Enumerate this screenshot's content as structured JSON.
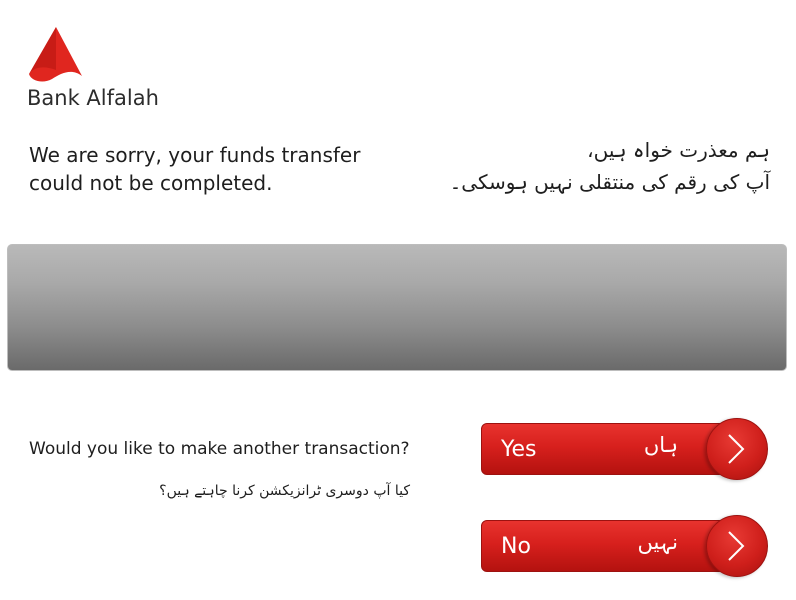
{
  "brand": {
    "name": "Bank Alfalah",
    "color": "#e0261f"
  },
  "message": {
    "english": [
      "We are sorry, your funds transfer",
      "could not be completed."
    ],
    "urdu": [
      "ہم معذرت خواہ ہیں،",
      "آپ کی رقم کی منتقلی نہیں ہوسکی۔"
    ]
  },
  "prompt": {
    "english": "Would you like to make another transaction?",
    "urdu": "کیا آپ دوسری ٹرانزیکشن کرنا چاہتے ہیں؟"
  },
  "buttons": {
    "yes": {
      "english": "Yes",
      "urdu": "ہاں",
      "icon": "chevron-right-icon"
    },
    "no": {
      "english": "No",
      "urdu": "نہیں",
      "icon": "chevron-right-icon"
    }
  },
  "colors": {
    "button_red": "#d7201d",
    "panel_gray": "#9a9a9a"
  }
}
